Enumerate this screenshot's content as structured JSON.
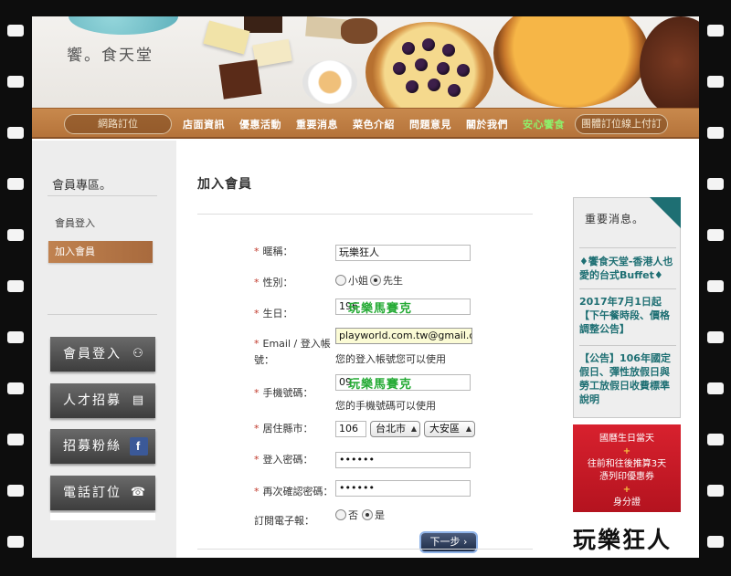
{
  "logo": {
    "text": "饗。食天堂"
  },
  "nav": {
    "order_online": "網路訂位",
    "items": [
      "店面資訊",
      "優惠活動",
      "重要消息",
      "菜色介紹",
      "問題意見",
      "關於我們"
    ],
    "highlight_item": "安心饗食",
    "group_booking": "團體訂位線上付訂"
  },
  "sidebar": {
    "title": "會員專區。",
    "link_login": "會員登入",
    "link_join": "加入會員",
    "buttons": [
      {
        "label": "會員登入",
        "icon": "members-icon"
      },
      {
        "label": "人才招募",
        "icon": "id-card-icon"
      },
      {
        "label": "招募粉絲",
        "icon": "facebook-icon",
        "glyph": "f"
      },
      {
        "label": "電話訂位",
        "icon": "phone-icon"
      }
    ]
  },
  "form": {
    "title": "加入會員",
    "nickname": {
      "label": "暱稱：",
      "value": "玩樂狂人"
    },
    "gender": {
      "label": "性別：",
      "options": [
        "小姐",
        "先生"
      ],
      "selected": "先生"
    },
    "birthday": {
      "label": "生日：",
      "value": "196",
      "overlay": "玩樂馬賽克"
    },
    "email": {
      "label_line1": "Email / 登入帳",
      "label_line2": "號：",
      "value": "playworld.com.tw@gmail.com",
      "hint": "您的登入帳號您可以使用"
    },
    "mobile": {
      "label": "手機號碼：",
      "value": "09",
      "overlay": "玩樂馬賽克",
      "hint": "您的手機號碼可以使用"
    },
    "address": {
      "label": "居住縣市：",
      "zip": "106",
      "city": "台北市",
      "district": "大安區"
    },
    "password": {
      "label": "登入密碼：",
      "value": "••••••"
    },
    "password_confirm": {
      "label": "再次確認密碼：",
      "value": "••••••"
    },
    "newsletter": {
      "label": "訂閱電子報：",
      "options": [
        "否",
        "是"
      ],
      "selected": "是"
    },
    "next_button": "下一步 ›"
  },
  "news": {
    "title": "重要消息。",
    "items": [
      "♦饗食天堂-香港人也愛的台式Buffet♦",
      "2017年7月1日起【下午餐時段、價格調整公告】",
      "【公告】106年國定假日、彈性放假日與勞工放假日收費標準說明"
    ]
  },
  "promo": {
    "line1": "國曆生日當天",
    "plus": "+",
    "line2": "往前和往後推算3天",
    "line3": "憑列印優惠券",
    "line4": "身分證"
  },
  "watermark": "玩樂狂人",
  "colors": {
    "accent_brown": "#b5733a",
    "news_teal": "#1e6f73",
    "promo_red": "#d8212e",
    "required": "#c0392b",
    "overlay_green": "#24aa34"
  }
}
